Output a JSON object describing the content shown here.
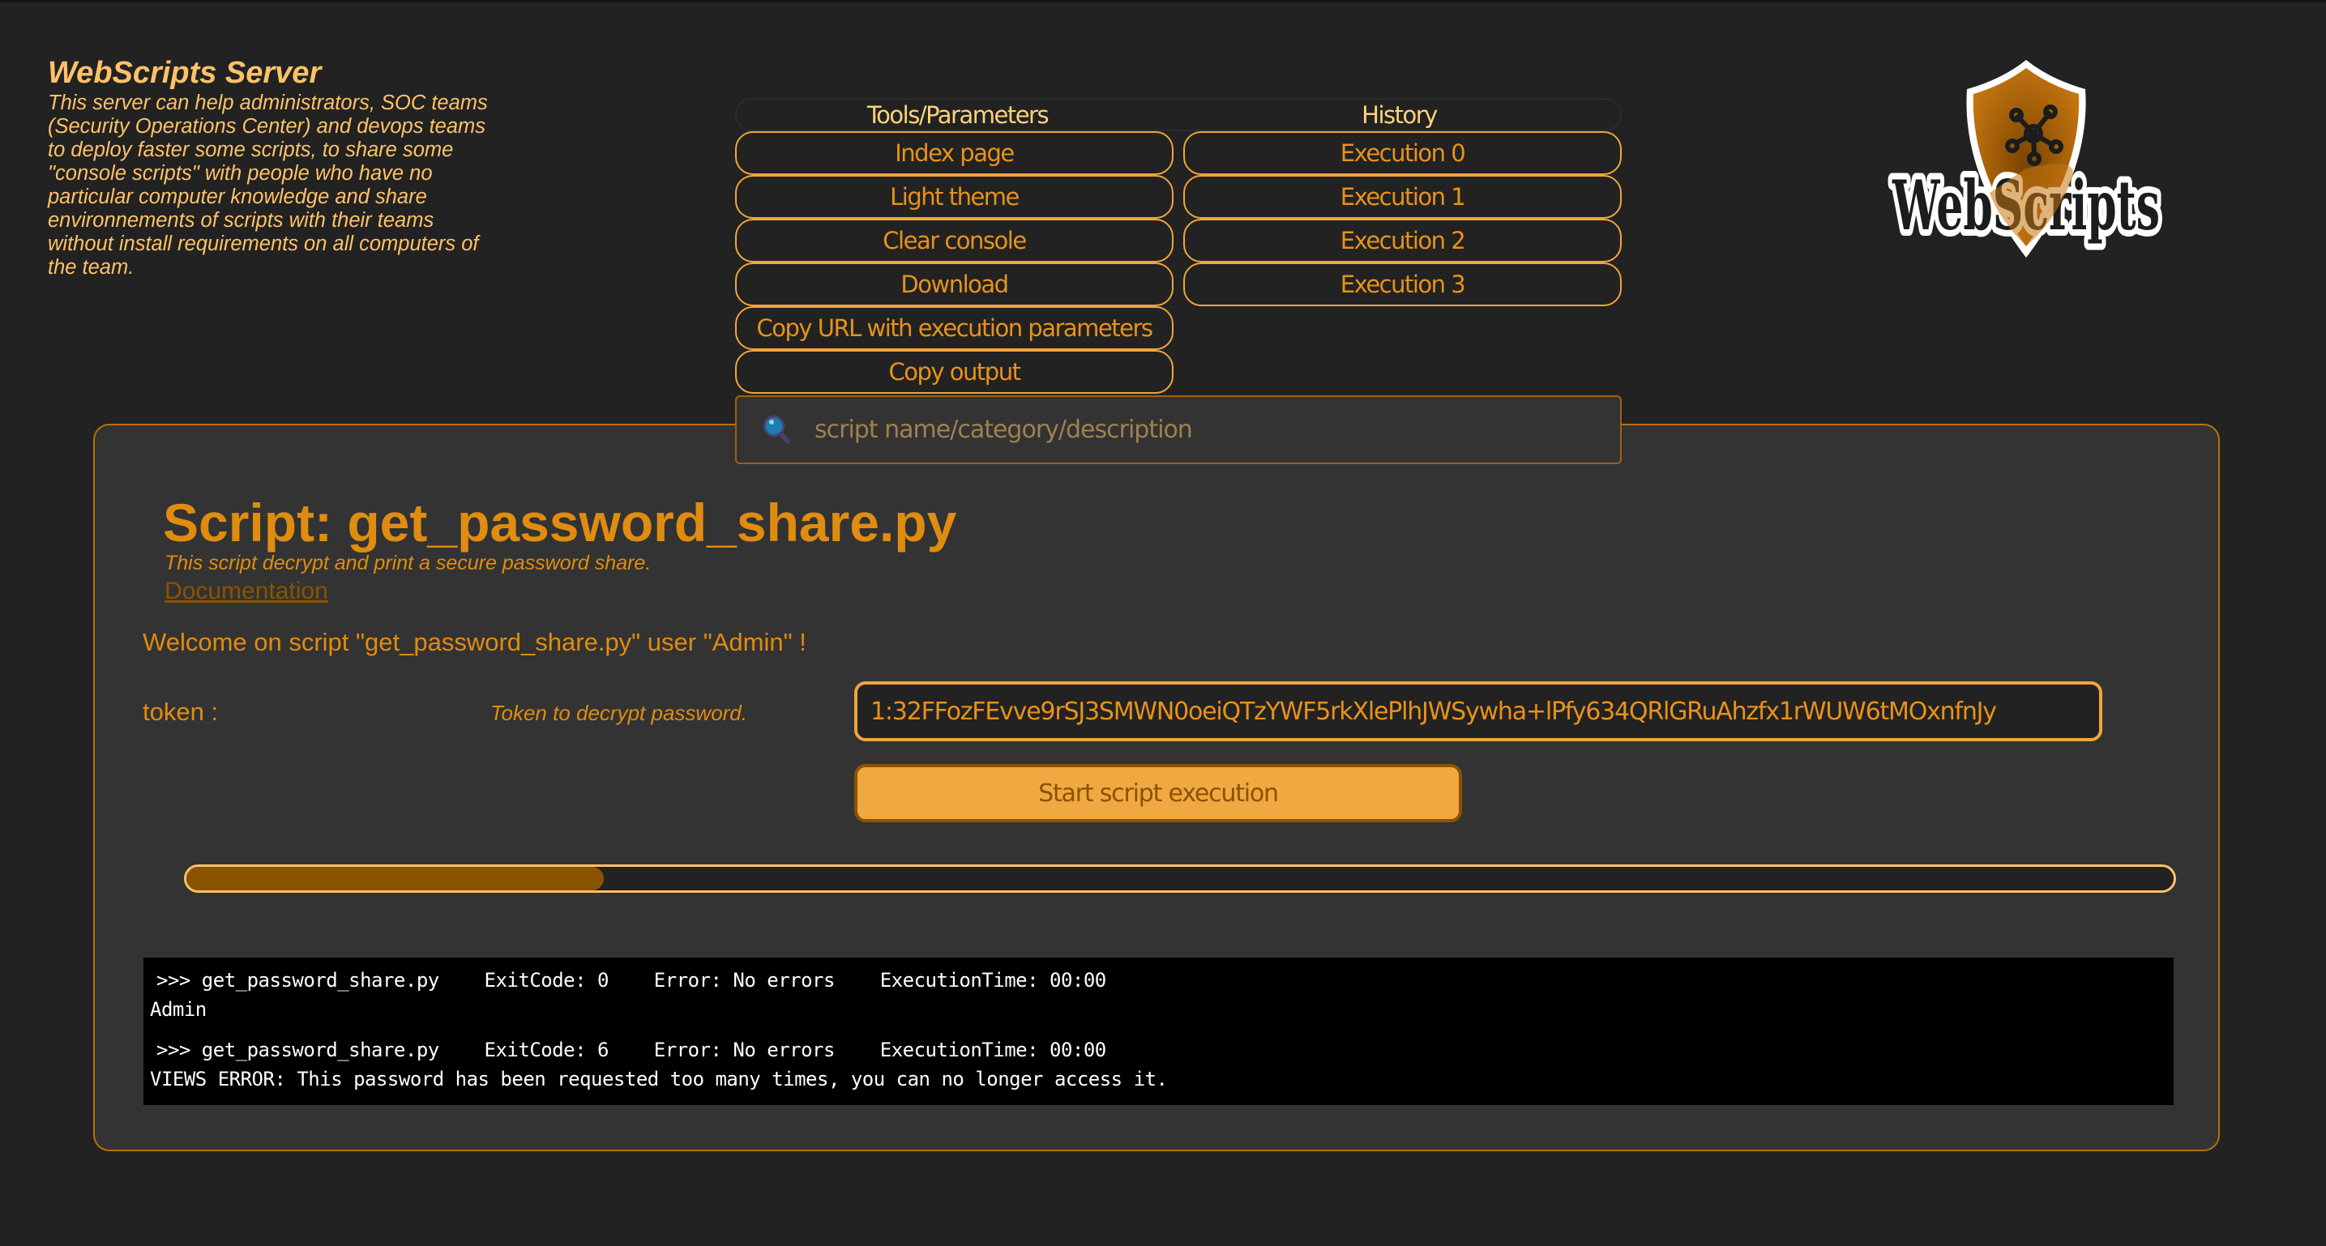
{
  "header": {
    "title": "WebScripts Server",
    "description": "This server can help administrators, SOC teams (Security Operations Center) and devops teams to deploy faster some scripts, to share some \"console scripts\" with people who have no particular computer knowledge and share environnements of scripts with their teams without install requirements on all computers of the team."
  },
  "nav": {
    "tools_header": "Tools/Parameters",
    "history_header": "History",
    "tools": [
      "Index page",
      "Light theme",
      "Clear console",
      "Download",
      "Copy URL with execution parameters",
      "Copy output"
    ],
    "history": [
      "Execution 0",
      "Execution 1",
      "Execution 2",
      "Execution 3"
    ]
  },
  "search": {
    "placeholder": "script name/category/description",
    "value": "",
    "icon": "magnifier-icon"
  },
  "logo": {
    "text": "WebScripts",
    "icon": "shield-network-icon"
  },
  "script": {
    "title": "Script: get_password_share.py",
    "description": "This script decrypt and print a secure password share.",
    "documentation_link": "Documentation",
    "welcome": "Welcome on script \"get_password_share.py\" user \"Admin\" !",
    "arguments": [
      {
        "label": "token :",
        "description": "Token to decrypt password.",
        "value": "1:32FFozFEvve9rSJ3SMWN0oeiQTzYWF5rkXlePlhJWSywha+lPfy634QRlGRuAhzfx1rWUW6tMOxnfnJy"
      }
    ],
    "start_button": "Start script execution",
    "progress_percent": 21
  },
  "console": {
    "entries": [
      {
        "command": ">>> get_password_share.py    ExitCode: 0    Error: No errors    ExecutionTime: 00:00",
        "output": "Admin"
      },
      {
        "command": ">>> get_password_share.py    ExitCode: 6    Error: No errors    ExecutionTime: 00:00",
        "output": "VIEWS ERROR: This password has been requested too many times, you can no longer access it."
      }
    ]
  },
  "colors": {
    "background": "#222222",
    "panel": "#333333",
    "accent": "#f0a53c",
    "text_accent": "#e08c10",
    "header_text": "#ffc267",
    "progress_fill": "#8b5200"
  }
}
